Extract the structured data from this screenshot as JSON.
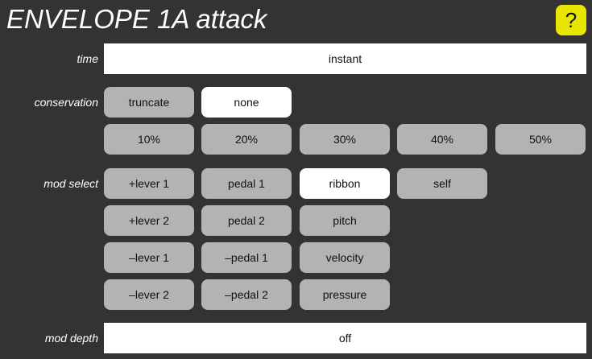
{
  "header": {
    "title": "ENVELOPE 1A attack",
    "help_label": "?"
  },
  "time": {
    "label": "time",
    "value": "instant"
  },
  "conservation": {
    "label": "conservation",
    "options": [
      "truncate",
      "none"
    ],
    "percents": [
      "10%",
      "20%",
      "30%",
      "40%",
      "50%"
    ],
    "selected": "none"
  },
  "mod_select": {
    "label": "mod select",
    "row1": [
      "+lever 1",
      "pedal 1",
      "ribbon",
      "self"
    ],
    "row2": [
      "+lever 2",
      "pedal 2",
      "pitch"
    ],
    "row3": [
      "–lever 1",
      "–pedal 1",
      "velocity"
    ],
    "row4": [
      "–lever 2",
      "–pedal 2",
      "pressure"
    ],
    "selected": "ribbon"
  },
  "mod_depth": {
    "label": "mod depth",
    "value": "off"
  },
  "colors": {
    "background": "#333333",
    "button": "#b3b3b3",
    "selected": "#ffffff",
    "help": "#e6e600"
  }
}
